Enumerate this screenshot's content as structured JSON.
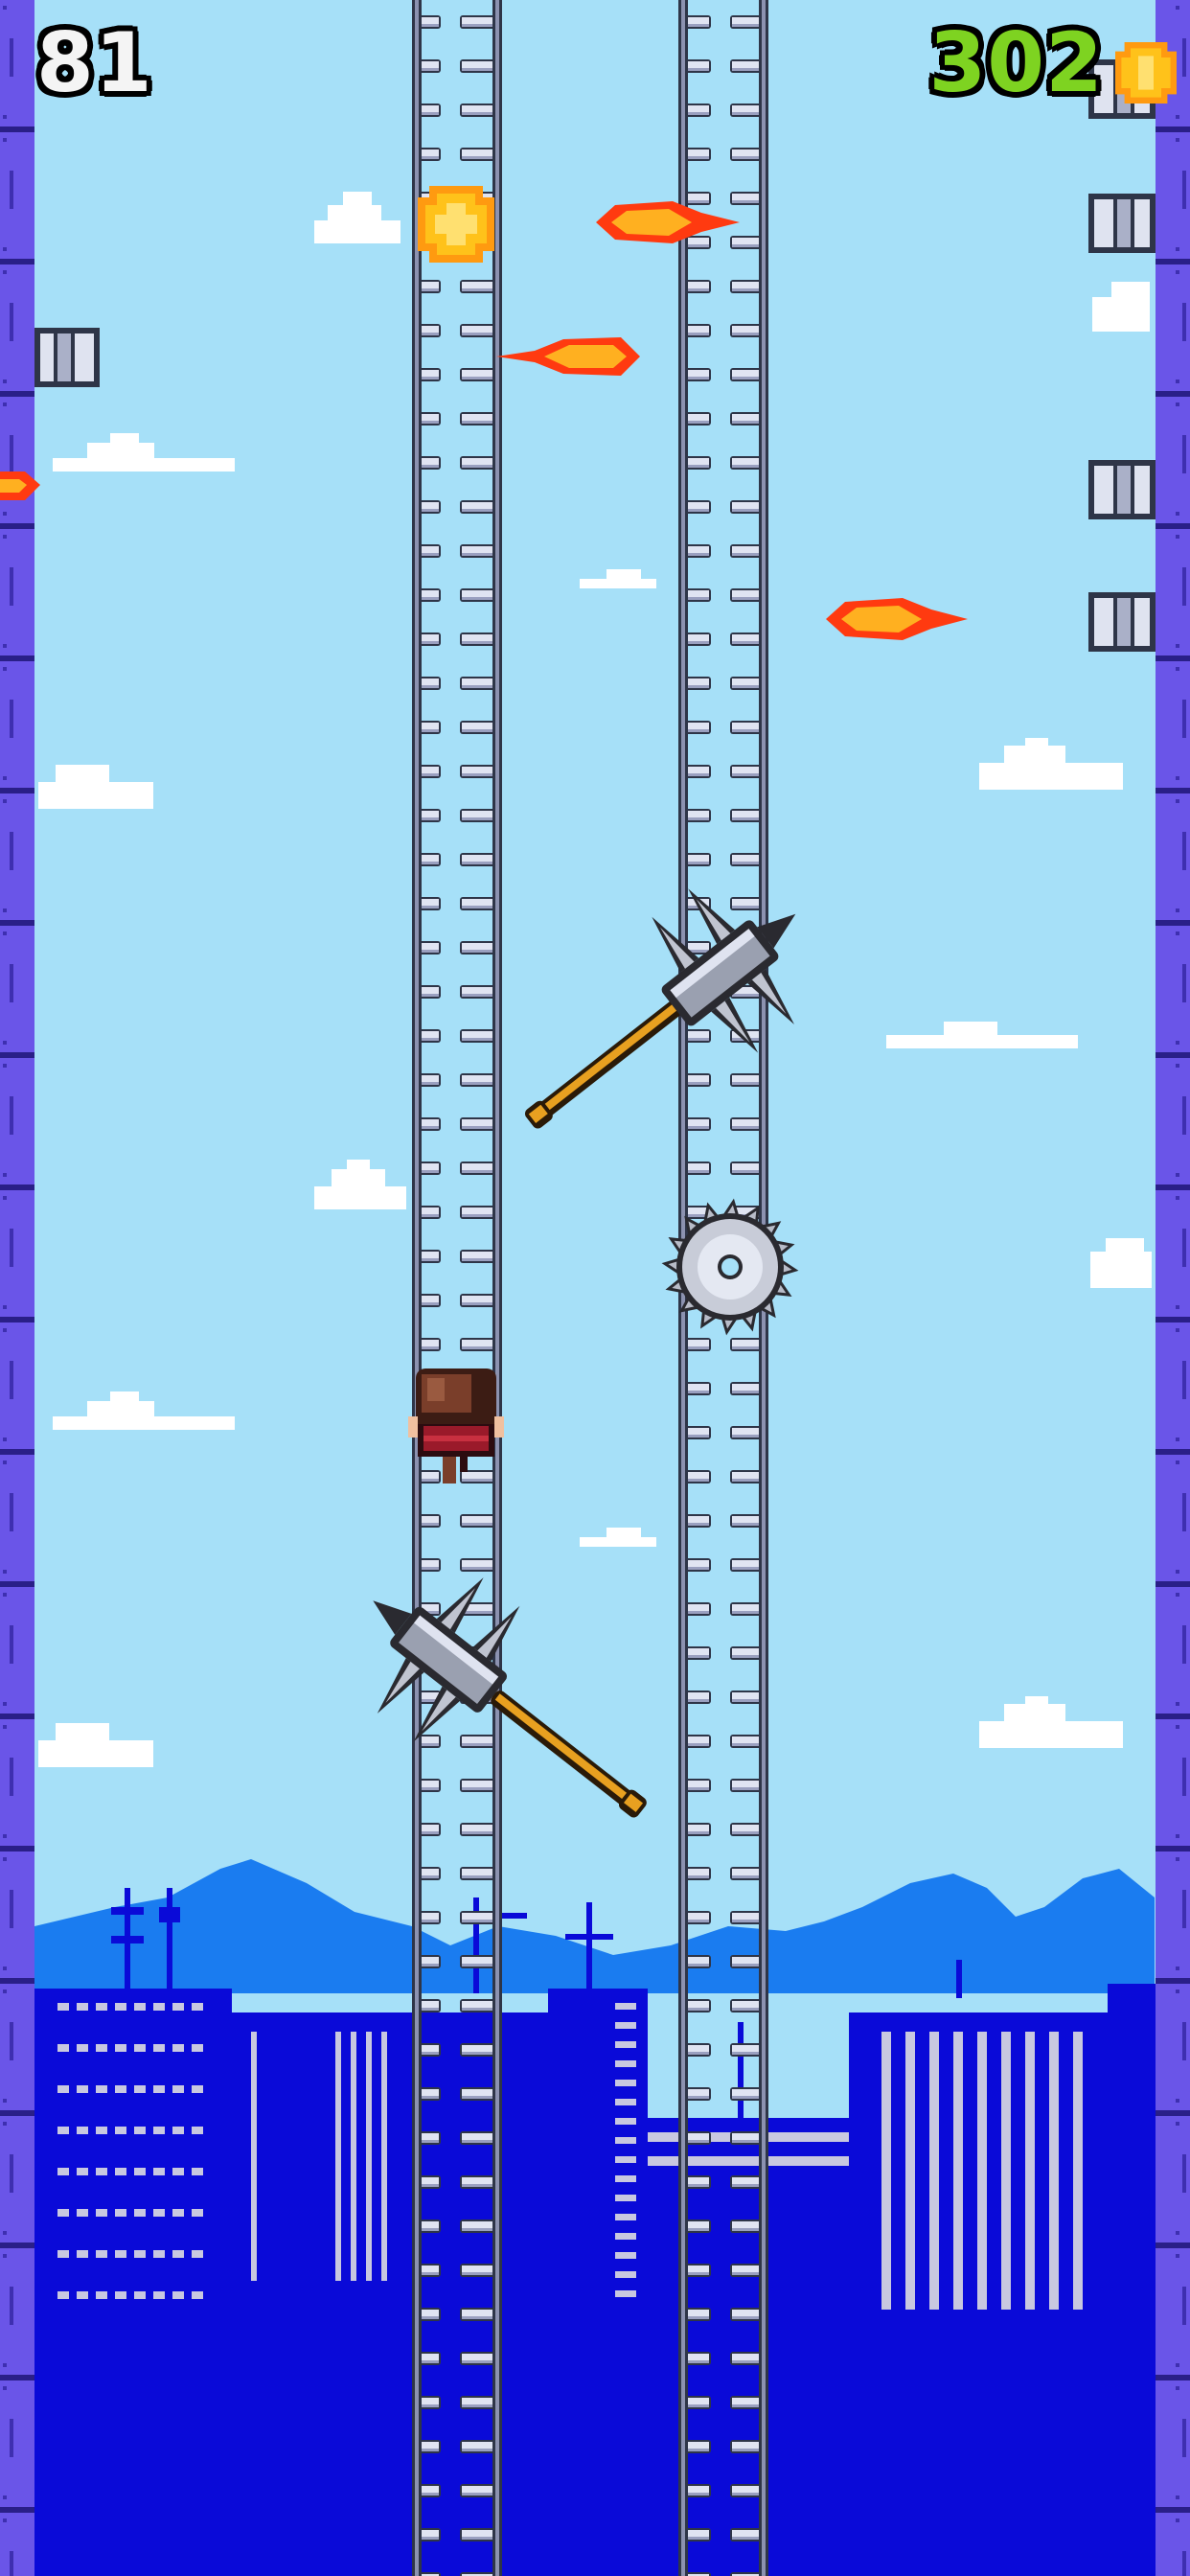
{
  "hud": {
    "height_score": "81",
    "coin_count": "302",
    "coin_count_color": "#7ed321",
    "coin_icon": "coin-icon"
  },
  "colors": {
    "sky": "#a6e0f8",
    "wall": "#6a55e8",
    "city": "#0a0ad8",
    "mountains": "#1a7cf0",
    "ladder_rail": "#2e3548",
    "ladder_rung": "#d8dcec",
    "fireball": "#ff5a1a",
    "coin": "#ffb21a"
  },
  "entities": {
    "player": "climber-player",
    "ladders": [
      "left-ladder",
      "right-ladder"
    ],
    "hazards": [
      "spiked-mace",
      "spiked-mace",
      "spinning-saw-blade",
      "fireball",
      "fireball",
      "fireball",
      "fireball"
    ],
    "pickups": [
      "gold-coin"
    ]
  }
}
